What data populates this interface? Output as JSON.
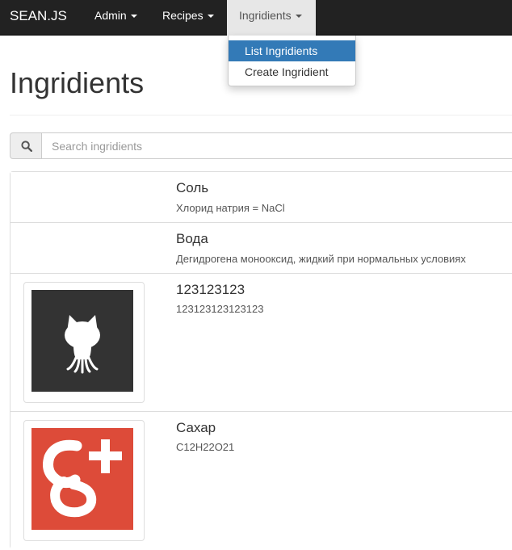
{
  "navbar": {
    "brand": "SEAN.JS",
    "items": [
      {
        "label": "Admin"
      },
      {
        "label": "Recipes"
      },
      {
        "label": "Ingridients"
      }
    ]
  },
  "dropdown": {
    "items": [
      {
        "label": "List Ingridients",
        "selected": true
      },
      {
        "label": "Create Ingridient",
        "selected": false
      }
    ]
  },
  "page": {
    "title": "Ingridients"
  },
  "search": {
    "placeholder": "Search ingridients",
    "value": "",
    "icon": "search-icon"
  },
  "ingredients": [
    {
      "name": "Соль",
      "description": "Хлорид натрия = NaCl",
      "image": null
    },
    {
      "name": "Вода",
      "description": "Дегидрогена монооксид, жидкий при нормальных условиях",
      "image": null
    },
    {
      "name": "123123123",
      "description": "123123123123123",
      "image": "github-octocat-logo"
    },
    {
      "name": "Сахар",
      "description": "C12H22O21",
      "image": "google-plus-logo"
    }
  ],
  "colors": {
    "navbar_bg": "#222222",
    "nav_active_bg": "#e7e7e7",
    "dropdown_selected_bg": "#337ab7",
    "github_bg": "#333333",
    "gplus_bg": "#dd4b39"
  }
}
